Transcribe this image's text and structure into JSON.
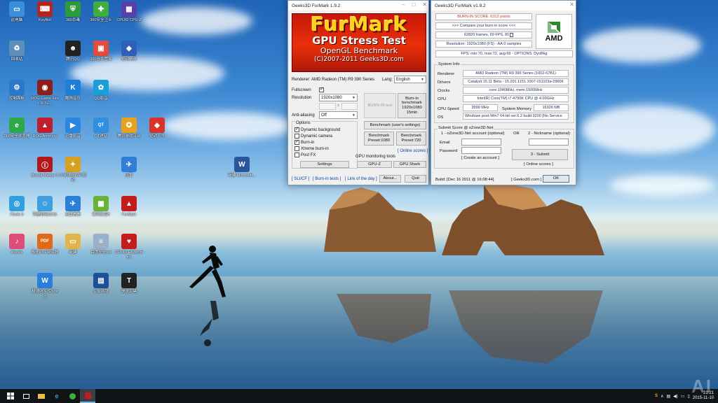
{
  "desktop": {
    "icons": [
      {
        "label": "此电脑",
        "color": "#3a8fd8",
        "glyph": "▭",
        "icon": "computer-icon"
      },
      {
        "label": "KeyBot",
        "color": "#b32424",
        "glyph": "⌨",
        "icon": "keyboard-icon"
      },
      {
        "label": "360杀毒",
        "color": "#2e9b3a",
        "glyph": "⛨",
        "icon": "shield-icon"
      },
      {
        "label": "360安全卫士",
        "color": "#3fae3f",
        "glyph": "✚",
        "icon": "360-guard-icon"
      },
      {
        "label": "CPUID CPU-Z",
        "color": "#5b3fa8",
        "glyph": "▦",
        "icon": "cpuz-icon"
      },
      {
        "label": "回收站",
        "color": "#5e8fb8",
        "glyph": "♻",
        "icon": "recycle-bin-icon"
      },
      {
        "label": "腾讯QQ",
        "color": "#222",
        "glyph": "☻",
        "icon": "qq-icon"
      },
      {
        "label": "360软件管家",
        "color": "#e34c3c",
        "glyph": "▣",
        "icon": "software-manager-icon"
      },
      {
        "label": "驱动精灵",
        "color": "#2f5fb8",
        "glyph": "◆",
        "icon": "driver-icon"
      },
      {
        "label": "控制面板",
        "color": "#2a78c8",
        "glyph": "⚙",
        "icon": "control-panel-icon"
      },
      {
        "label": "ROG Game First III Tu...",
        "color": "#8a1f1f",
        "glyph": "◉",
        "icon": "rog-gamefirst-icon"
      },
      {
        "label": "酷狗音乐",
        "color": "#1e7fd8",
        "glyph": "K",
        "icon": "kugou-icon"
      },
      {
        "label": "QQ影音",
        "color": "#1a9fd8",
        "glyph": "✿",
        "icon": "qq-player-icon"
      },
      {
        "label": "360安全浏览器",
        "color": "#2fa84a",
        "glyph": "e",
        "icon": "browser-icon"
      },
      {
        "label": "ROG Armoury",
        "color": "#c01e2a",
        "glyph": "▲",
        "icon": "rog-armoury-icon"
      },
      {
        "label": "迅雷影音",
        "color": "#2a86e0",
        "glyph": "▶",
        "icon": "xunlei-player-icon"
      },
      {
        "label": "QT语音",
        "color": "#2f8fe0",
        "glyph": "QT",
        "icon": "qt-voice-icon"
      },
      {
        "label": "腾讯游戏平台",
        "color": "#e8a21a",
        "glyph": "✪",
        "icon": "tencent-games-icon"
      },
      {
        "label": "驱动人生",
        "color": "#d8342a",
        "glyph": "◆",
        "icon": "driver-life-icon"
      },
      {
        "label": "Bonds Master II",
        "color": "#b3161c",
        "glyph": "Ⓘ",
        "icon": "bonds-master-icon"
      },
      {
        "label": "小米随身WiFi驱动",
        "color": "#d8a020",
        "glyph": "✦",
        "icon": "wifi-driver-icon"
      },
      {
        "label": "迅雷",
        "color": "#2f7fd8",
        "glyph": "✈",
        "icon": "thunder-icon"
      },
      {
        "label": "新建 Microsoft...",
        "color": "#2b579a",
        "glyph": "W",
        "icon": "word-document-icon"
      },
      {
        "label": "iTools 3",
        "color": "#2f9fe0",
        "glyph": "◎",
        "icon": "itools-icon"
      },
      {
        "label": "阿里旺旺2016",
        "color": "#3fa0e0",
        "glyph": "☺",
        "icon": "aliwangwang-icon"
      },
      {
        "label": "迅雷看看",
        "color": "#2a80d8",
        "glyph": "✈",
        "icon": "xunlei-kankan-icon"
      },
      {
        "label": "暴风影音5",
        "color": "#6ab33a",
        "glyph": "▦",
        "icon": "baofeng-icon"
      },
      {
        "label": "FurMark",
        "color": "#c21c1c",
        "glyph": "▲",
        "icon": "furmark-icon"
      },
      {
        "label": "iTunes",
        "color": "#e04c7a",
        "glyph": "♪",
        "icon": "itunes-icon"
      },
      {
        "label": "极速PDF阅读器",
        "color": "#e06a1a",
        "glyph": "PDF",
        "icon": "pdf-reader-icon"
      },
      {
        "label": "新建",
        "color": "#e0b64a",
        "glyph": "▭",
        "icon": "folder-icon"
      },
      {
        "label": "百度安全.txt",
        "color": "#9ab0c8",
        "glyph": "≡",
        "icon": "text-file-icon"
      },
      {
        "label": "CPUID HWMonitor",
        "color": "#c21c1c",
        "glyph": "♥",
        "icon": "hwmonitor-icon"
      },
      {
        "label": "极速PDF转Word",
        "color": "#2a7fd8",
        "glyph": "W",
        "icon": "pdf-to-word-icon"
      },
      {
        "label": "企业网银",
        "color": "#1d4f9a",
        "glyph": "▤",
        "icon": "bank-icon"
      },
      {
        "label": "快速工具",
        "color": "#222",
        "glyph": "T",
        "icon": "tools-icon"
      }
    ]
  },
  "furmark": {
    "title": "Geeks3D FurMark 1.9.2",
    "banner": {
      "line1": "FurMark",
      "line2": "GPU Stress Test",
      "line3": "OpenGL Benchmark",
      "line4": "(C)2007-2011 Geeks3D.com"
    },
    "renderer_label": "Renderer: AMD Radeon (TM) R9 390 Series",
    "lang_label": "Lang:",
    "lang_value": "English",
    "fullscreen_label": "Fullscreen",
    "resolution_label": "Resolution",
    "resolution_value": "1920x1080",
    "x_label": "x",
    "aa_label": "Anti-aliasing",
    "aa_value": "Off",
    "options_label": "Options",
    "options": [
      {
        "label": "Dynamic background",
        "checked": true
      },
      {
        "label": "Dynamic camera",
        "checked": false
      },
      {
        "label": "Burn-in",
        "checked": true
      },
      {
        "label": "Xtreme burn-in",
        "checked": false
      },
      {
        "label": "Post FX",
        "checked": false
      }
    ],
    "settings_btn": "Settings",
    "burnin_test_btn": "BURN-IN test",
    "burnin_bench_btn": "Burn-in benchmark 1920x1080 15min",
    "bench_user_btn": "Benchmark (user's settings)",
    "preset1080_btn": "Benchmark Preset:1080",
    "preset720_btn": "Benchmark Preset:720",
    "online_scores": "[ Online scores ]",
    "gpu_tools_label": "GPU monitoring tools",
    "gpuz_btn": "GPU-Z",
    "gpushark_btn": "GPU Shark",
    "links": [
      "[ SLI/CF ]",
      "[ Burn-in tests ]",
      "[ Link of the day ]"
    ],
    "about_btn": "About...",
    "quit_btn": "Quit"
  },
  "results": {
    "title": "Geeks3D FurMark v1.9.2",
    "score": "BURN-IN SCORE: 6312 points",
    "compare": ">>> Compare your burn-in score <<<",
    "frames": "62820 frames, 69 FPS, 81",
    "resolution": "Resolution: 1920x1080 (FS) - AA:0 samples",
    "fps": "FPS: min:70, max:72, avg:69 - OPTIONS: DynBkg",
    "amd_logo": "AMD",
    "sysinfo_label": "System Info",
    "rows": [
      {
        "label": "Renderer",
        "value": "AMD Radeon (TM) R9 390 Series (1002-67B1)"
      },
      {
        "label": "Drivers",
        "value": "Catalyst 15.11 Beta - 15.201.1151.1007-151103a-29606"
      },
      {
        "label": "Clocks",
        "value": "core:1040MHz, mem:1500MHz"
      },
      {
        "label": "CPU",
        "value": "Intel(R) Core(TM) i7-4790K CPU @ 4.00GHz"
      }
    ],
    "cpu_speed_label": "CPU Speed",
    "cpu_speed_value": "3999 MHz",
    "sys_mem_label": "System Memory",
    "sys_mem_value": "16326 MB",
    "os_label": "OS",
    "os_value": "Windows post-Win7 64-bit ver.6.2 build 9200 [No Service",
    "submit_label": "Submit Score @ oZone3D.Net",
    "account_label": "1 - oZone3D.Net account (optional)",
    "or_label": "OR",
    "nickname_label": "2 - Nickname (optional)",
    "email_label": "Email",
    "password_label": "Password",
    "create_account": "[ Create an account ]",
    "submit_btn": "3 - Submit",
    "online_scores": "[ Online scores ]",
    "build": "Build: [Dec 16 2011 @ 16:08:44]",
    "site_link": "[ Geeks3D.com ]",
    "ok_btn": "OK"
  },
  "taskbar": {
    "time": "21:21",
    "date": "2015-11-10",
    "watermark": "AI"
  }
}
